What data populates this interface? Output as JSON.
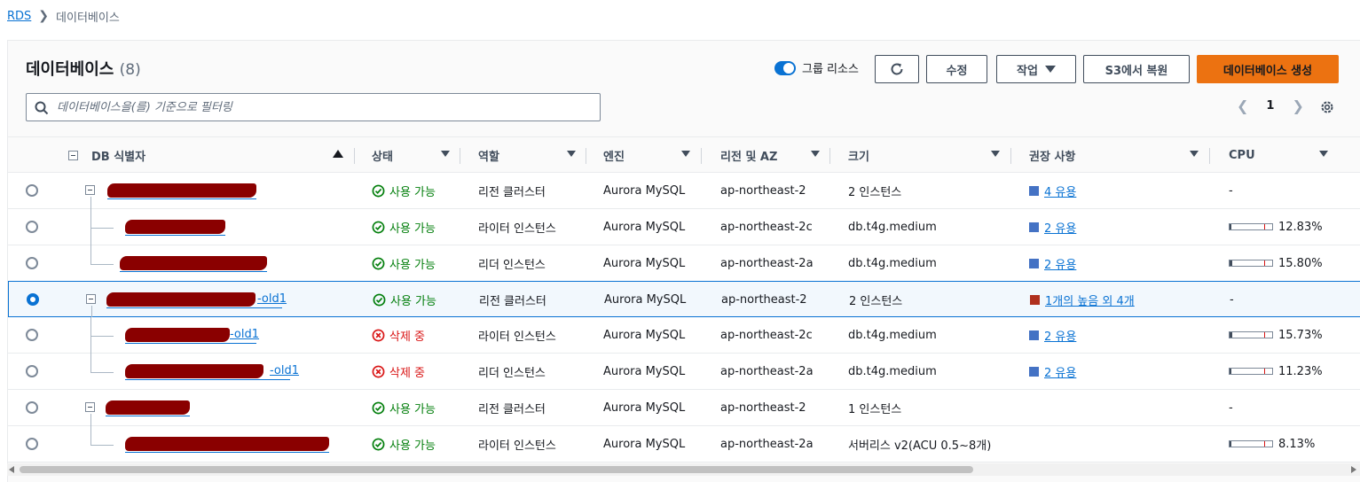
{
  "breadcrumb": {
    "root": "RDS",
    "current": "데이터베이스"
  },
  "panel": {
    "title": "데이터베이스",
    "count": "(8)"
  },
  "toolbar": {
    "group_toggle_label": "그룹 리소스",
    "modify": "수정",
    "actions": "작업",
    "restore_s3": "S3에서 복원",
    "create": "데이터베이스 생성"
  },
  "filter": {
    "placeholder": "데이터베이스을(를) 기준으로 필터링"
  },
  "pagination": {
    "page": "1"
  },
  "columns": {
    "id": "DB 식별자",
    "status": "상태",
    "role": "역할",
    "engine": "엔진",
    "region": "리전 및 AZ",
    "size": "크기",
    "recommendation": "권장 사항",
    "cpu": "CPU"
  },
  "colors": {
    "ok": "#037f0c",
    "deleting": "#d91515",
    "rec_info": "#4472c4",
    "rec_high": "#b0301e",
    "primary": "#ec7211",
    "link": "#0972d3"
  },
  "rows": [
    {
      "id_suffix": "",
      "status": "사용 가능",
      "role": "리전 클러스터",
      "engine": "Aurora MySQL",
      "region": "ap-northeast-2",
      "size": "2 인스턴스",
      "rec": "4 유용",
      "cpu": "-"
    },
    {
      "id_suffix": "",
      "status": "사용 가능",
      "role": "라이터 인스턴스",
      "engine": "Aurora MySQL",
      "region": "ap-northeast-2c",
      "size": "db.t4g.medium",
      "rec": "2 유용",
      "cpu": "12.83%",
      "cpu_value": 12.83
    },
    {
      "id_suffix": "",
      "status": "사용 가능",
      "role": "리더 인스턴스",
      "engine": "Aurora MySQL",
      "region": "ap-northeast-2a",
      "size": "db.t4g.medium",
      "rec": "2 유용",
      "cpu": "15.80%",
      "cpu_value": 15.8
    },
    {
      "id_suffix": "-old1",
      "status": "사용 가능",
      "role": "리전 클러스터",
      "engine": "Aurora MySQL",
      "region": "ap-northeast-2",
      "size": "2 인스턴스",
      "rec": "1개의 높음 외 4개",
      "cpu": "-"
    },
    {
      "id_suffix": "-old1",
      "status": "삭제 중",
      "role": "라이터 인스턴스",
      "engine": "Aurora MySQL",
      "region": "ap-northeast-2c",
      "size": "db.t4g.medium",
      "rec": "2 유용",
      "cpu": "15.73%",
      "cpu_value": 15.73
    },
    {
      "id_suffix": "-old1",
      "status": "삭제 중",
      "role": "리더 인스턴스",
      "engine": "Aurora MySQL",
      "region": "ap-northeast-2a",
      "size": "db.t4g.medium",
      "rec": "2 유용",
      "cpu": "11.23%",
      "cpu_value": 11.23
    },
    {
      "id_suffix": "",
      "status": "사용 가능",
      "role": "리전 클러스터",
      "engine": "Aurora MySQL",
      "region": "ap-northeast-2",
      "size": "1 인스턴스",
      "rec": "",
      "cpu": "-"
    },
    {
      "id_suffix": "",
      "status": "사용 가능",
      "role": "라이터 인스턴스",
      "engine": "Aurora MySQL",
      "region": "ap-northeast-2a",
      "size": "서버리스 v2(ACU 0.5~8개)",
      "rec": "",
      "cpu": "8.13%",
      "cpu_value": 8.13
    }
  ]
}
